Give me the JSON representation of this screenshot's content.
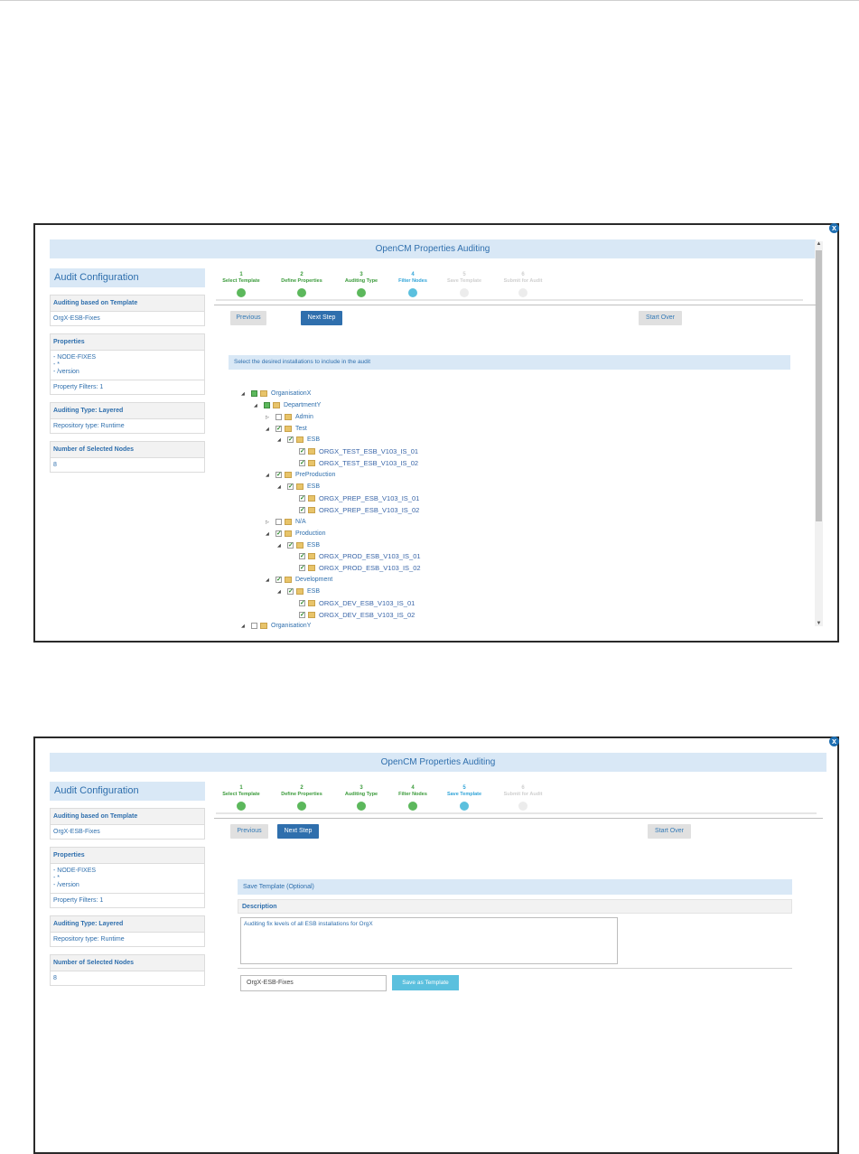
{
  "panel1": {
    "title": "OpenCM Properties Auditing",
    "sidebar": {
      "header": "Audit Configuration",
      "template_label": "Auditing based on Template",
      "template_value": "OrgX-ESB-Fixes",
      "properties_label": "Properties",
      "properties": [
        "- NODE-FIXES",
        "- *",
        "- /version"
      ],
      "property_filters": "Property Filters: 1",
      "auditing_type": "Auditing Type: Layered",
      "repository_type": "Repository type: Runtime",
      "nodes_label": "Number of Selected Nodes",
      "nodes_value": "8"
    },
    "steps": [
      {
        "num": "1",
        "label": "Select Template",
        "state": "done"
      },
      {
        "num": "2",
        "label": "Define Properties",
        "state": "done"
      },
      {
        "num": "3",
        "label": "Auditing Type",
        "state": "done"
      },
      {
        "num": "4",
        "label": "Filter Nodes",
        "state": "current"
      },
      {
        "num": "5",
        "label": "Save Template",
        "state": "off"
      },
      {
        "num": "6",
        "label": "Submit for Audit",
        "state": "off"
      }
    ],
    "buttons": {
      "previous": "Previous",
      "next": "Next Step",
      "start_over": "Start Over"
    },
    "select_prompt": "Select the desired installations to include in the audit",
    "tree": [
      "OrganisationX",
      "DepartmentY",
      "Admin",
      "Test",
      "ESB",
      "ORGX_TEST_ESB_V103_IS_01",
      "ORGX_TEST_ESB_V103_IS_02",
      "PreProduction",
      "ESB",
      "ORGX_PREP_ESB_V103_IS_01",
      "ORGX_PREP_ESB_V103_IS_02",
      "N/A",
      "Production",
      "ESB",
      "ORGX_PROD_ESB_V103_IS_01",
      "ORGX_PROD_ESB_V103_IS_02",
      "Development",
      "ESB",
      "ORGX_DEV_ESB_V103_IS_01",
      "ORGX_DEV_ESB_V103_IS_02",
      "OrganisationY"
    ]
  },
  "panel2": {
    "title": "OpenCM Properties Auditing",
    "sidebar": {
      "header": "Audit Configuration",
      "template_label": "Auditing based on Template",
      "template_value": "OrgX-ESB-Fixes",
      "properties_label": "Properties",
      "properties": [
        "- NODE-FIXES",
        "- *",
        "- /version"
      ],
      "property_filters": "Property Filters: 1",
      "auditing_type": "Auditing Type: Layered",
      "repository_type": "Repository type: Runtime",
      "nodes_label": "Number of Selected Nodes",
      "nodes_value": "8"
    },
    "steps": [
      {
        "num": "1",
        "label": "Select Template",
        "state": "done"
      },
      {
        "num": "2",
        "label": "Define Properties",
        "state": "done"
      },
      {
        "num": "3",
        "label": "Auditing Type",
        "state": "done"
      },
      {
        "num": "4",
        "label": "Filter Nodes",
        "state": "done"
      },
      {
        "num": "5",
        "label": "Save Template",
        "state": "current"
      },
      {
        "num": "6",
        "label": "Submit for Audit",
        "state": "off"
      }
    ],
    "buttons": {
      "previous": "Previous",
      "next": "Next Step",
      "start_over": "Start Over"
    },
    "save_header": "Save Template (Optional)",
    "description_label": "Description",
    "description_value": "Auditing fix levels of all ESB installations for OrgX",
    "template_name": "OrgX-ESB-Fixes",
    "save_button": "Save as Template"
  },
  "icons": {
    "close": "close-icon",
    "folder": "folder-icon",
    "checkbox": "checkbox-icon",
    "expand": "expand-arrow-icon"
  },
  "colors": {
    "accent": "#2f6fad",
    "done": "#5cb85c",
    "current": "#5bc0de",
    "header_bg": "#d9e8f6"
  }
}
